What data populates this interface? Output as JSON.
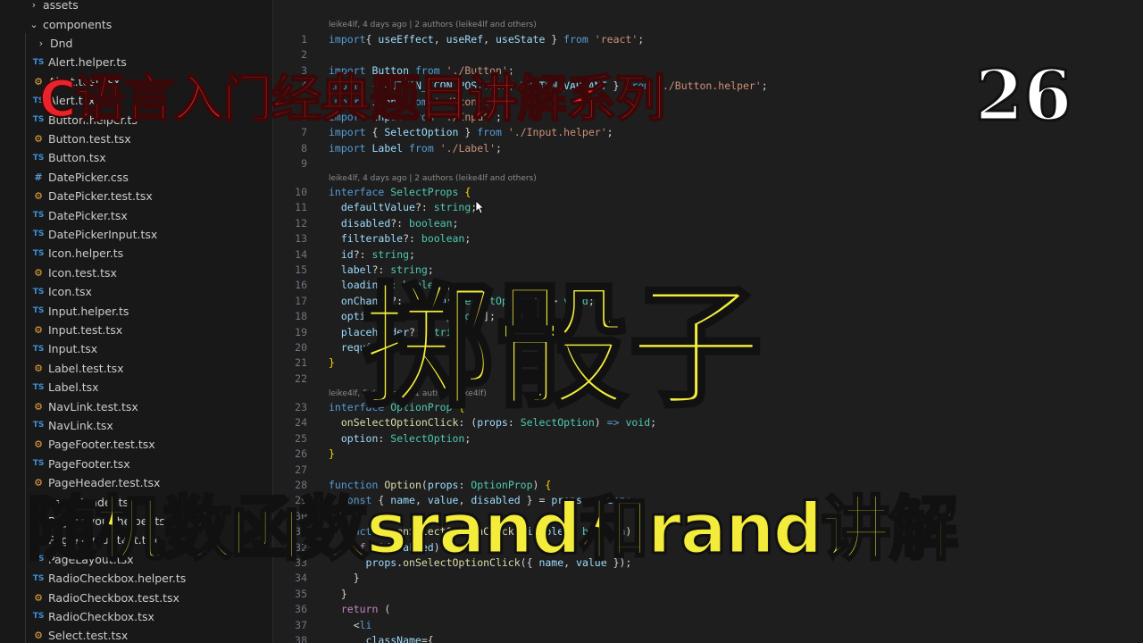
{
  "sidebar": {
    "items": [
      {
        "label": "assets",
        "kind": "folder",
        "chev": "›"
      },
      {
        "label": "components",
        "kind": "folder-open",
        "chev": "⌄"
      },
      {
        "label": "Dnd",
        "kind": "folder",
        "chev": "›"
      },
      {
        "label": "Alert.helper.ts",
        "kind": "ts"
      },
      {
        "label": "Alert.test.tsx",
        "kind": "test"
      },
      {
        "label": "Alert.tsx",
        "kind": "ts"
      },
      {
        "label": "Button.helper.ts",
        "kind": "ts"
      },
      {
        "label": "Button.test.tsx",
        "kind": "test"
      },
      {
        "label": "Button.tsx",
        "kind": "ts"
      },
      {
        "label": "DatePicker.css",
        "kind": "css"
      },
      {
        "label": "DatePicker.test.tsx",
        "kind": "test"
      },
      {
        "label": "DatePicker.tsx",
        "kind": "ts"
      },
      {
        "label": "DatePickerInput.tsx",
        "kind": "ts"
      },
      {
        "label": "Icon.helper.ts",
        "kind": "ts"
      },
      {
        "label": "Icon.test.tsx",
        "kind": "test"
      },
      {
        "label": "Icon.tsx",
        "kind": "ts"
      },
      {
        "label": "Input.helper.ts",
        "kind": "ts"
      },
      {
        "label": "Input.test.tsx",
        "kind": "test"
      },
      {
        "label": "Input.tsx",
        "kind": "ts"
      },
      {
        "label": "Label.test.tsx",
        "kind": "test"
      },
      {
        "label": "Label.tsx",
        "kind": "ts"
      },
      {
        "label": "NavLink.test.tsx",
        "kind": "test"
      },
      {
        "label": "NavLink.tsx",
        "kind": "ts"
      },
      {
        "label": "PageFooter.test.tsx",
        "kind": "test"
      },
      {
        "label": "PageFooter.tsx",
        "kind": "ts"
      },
      {
        "label": "PageHeader.test.tsx",
        "kind": "test"
      },
      {
        "label": "PageHeader.tsx",
        "kind": "ts"
      },
      {
        "label": "PageLayout.helper.ts",
        "kind": "ts"
      },
      {
        "label": "PageLayout.test.tsx",
        "kind": "test"
      },
      {
        "label": "PageLayout.tsx",
        "kind": "ts"
      },
      {
        "label": "RadioCheckbox.helper.ts",
        "kind": "ts"
      },
      {
        "label": "RadioCheckbox.test.tsx",
        "kind": "test"
      },
      {
        "label": "RadioCheckbox.tsx",
        "kind": "ts"
      },
      {
        "label": "Select.test.tsx",
        "kind": "test"
      }
    ],
    "icon_text": {
      "ts": "TS",
      "test": "⚙",
      "css": "#"
    }
  },
  "editor": {
    "blame": [
      {
        "text": "leike4lf, 4 days ago | 2 authors (leike4lf and others)",
        "before_line": 1
      },
      {
        "text": "leike4lf, 4 days ago | 2 authors (leike4lf and others)",
        "before_line": 10
      },
      {
        "text": "leike4lf, 5 days ago | 1 author (leike4lf)",
        "before_line": 23
      }
    ],
    "lines": [
      {
        "n": "1",
        "tokens": [
          [
            "kw",
            "import"
          ],
          [
            "",
            "{ "
          ],
          [
            "var",
            "useEffect"
          ],
          [
            "",
            ", "
          ],
          [
            "var",
            "useRef"
          ],
          [
            "",
            ", "
          ],
          [
            "var",
            "useState"
          ],
          [
            "",
            " } "
          ],
          [
            "kw",
            "from"
          ],
          [
            "",
            " "
          ],
          [
            "str",
            "'react'"
          ],
          [
            "",
            ";"
          ]
        ]
      },
      {
        "n": "2",
        "tokens": []
      },
      {
        "n": "3",
        "tokens": [
          [
            "kw",
            "import"
          ],
          [
            "",
            " "
          ],
          [
            "var",
            "Button"
          ],
          [
            "",
            " "
          ],
          [
            "kw",
            "from"
          ],
          [
            "",
            " "
          ],
          [
            "str",
            "'./Button'"
          ],
          [
            "",
            ";"
          ]
        ]
      },
      {
        "n": "4",
        "tokens": [
          [
            "kw",
            "import"
          ],
          [
            "",
            " { "
          ],
          [
            "var",
            "BUTTON_ICON_POSITION"
          ],
          [
            "",
            ", "
          ],
          [
            "var",
            "BUTTON_VARIANT"
          ],
          [
            "",
            " } "
          ],
          [
            "kw",
            "from"
          ],
          [
            "",
            " "
          ],
          [
            "str",
            "'./Button.helper'"
          ],
          [
            "",
            ";"
          ]
        ]
      },
      {
        "n": "5",
        "tokens": [
          [
            "kw",
            "import"
          ],
          [
            "",
            " "
          ],
          [
            "var",
            "Icon"
          ],
          [
            "",
            " "
          ],
          [
            "kw",
            "from"
          ],
          [
            "",
            " "
          ],
          [
            "str",
            "'./Icon'"
          ],
          [
            "",
            ";"
          ]
        ]
      },
      {
        "n": "6",
        "tokens": [
          [
            "kw",
            "import"
          ],
          [
            "",
            " "
          ],
          [
            "var",
            "Input"
          ],
          [
            "",
            " "
          ],
          [
            "kw",
            "from"
          ],
          [
            "",
            " "
          ],
          [
            "str",
            "'./Input'"
          ],
          [
            "",
            ";"
          ]
        ]
      },
      {
        "n": "7",
        "tokens": [
          [
            "kw",
            "import"
          ],
          [
            "",
            " { "
          ],
          [
            "var",
            "SelectOption"
          ],
          [
            "",
            " } "
          ],
          [
            "kw",
            "from"
          ],
          [
            "",
            " "
          ],
          [
            "str",
            "'./Input.helper'"
          ],
          [
            "",
            ";"
          ]
        ]
      },
      {
        "n": "8",
        "tokens": [
          [
            "kw",
            "import"
          ],
          [
            "",
            " "
          ],
          [
            "var",
            "Label"
          ],
          [
            "",
            " "
          ],
          [
            "kw",
            "from"
          ],
          [
            "",
            " "
          ],
          [
            "str",
            "'./Label'"
          ],
          [
            "",
            ";"
          ]
        ]
      },
      {
        "n": "9",
        "tokens": []
      },
      {
        "n": "10",
        "tokens": [
          [
            "kw",
            "interface"
          ],
          [
            "",
            " "
          ],
          [
            "type",
            "SelectProps"
          ],
          [
            "",
            " "
          ],
          [
            "punc",
            "{"
          ]
        ]
      },
      {
        "n": "11",
        "tokens": [
          [
            "",
            "  "
          ],
          [
            "var",
            "defaultValue"
          ],
          [
            "",
            "?: "
          ],
          [
            "type",
            "string"
          ],
          [
            "",
            ";"
          ]
        ]
      },
      {
        "n": "12",
        "tokens": [
          [
            "",
            "  "
          ],
          [
            "var",
            "disabled"
          ],
          [
            "",
            "?: "
          ],
          [
            "type",
            "boolean"
          ],
          [
            "",
            ";"
          ]
        ]
      },
      {
        "n": "13",
        "tokens": [
          [
            "",
            "  "
          ],
          [
            "var",
            "filterable"
          ],
          [
            "",
            "?: "
          ],
          [
            "type",
            "boolean"
          ],
          [
            "",
            ";"
          ]
        ]
      },
      {
        "n": "14",
        "tokens": [
          [
            "",
            "  "
          ],
          [
            "var",
            "id"
          ],
          [
            "",
            "?: "
          ],
          [
            "type",
            "string"
          ],
          [
            "",
            ";"
          ]
        ]
      },
      {
        "n": "15",
        "tokens": [
          [
            "",
            "  "
          ],
          [
            "var",
            "label"
          ],
          [
            "",
            "?: "
          ],
          [
            "type",
            "string"
          ],
          [
            "",
            ";"
          ]
        ]
      },
      {
        "n": "16",
        "tokens": [
          [
            "",
            "  "
          ],
          [
            "var",
            "loading"
          ],
          [
            "",
            "?: "
          ],
          [
            "type",
            "boolean"
          ],
          [
            "",
            ";"
          ]
        ]
      },
      {
        "n": "17",
        "tokens": [
          [
            "",
            "  "
          ],
          [
            "var",
            "onChange"
          ],
          [
            "",
            "?: ("
          ],
          [
            "var",
            "param"
          ],
          [
            "",
            ": "
          ],
          [
            "type",
            "SelectOption"
          ],
          [
            "",
            ") => "
          ],
          [
            "type",
            "void"
          ],
          [
            "",
            ";"
          ]
        ]
      },
      {
        "n": "18",
        "tokens": [
          [
            "",
            "  "
          ],
          [
            "var",
            "options"
          ],
          [
            "",
            "?: "
          ],
          [
            "type",
            "SelectOption"
          ],
          [
            "",
            "[];"
          ]
        ]
      },
      {
        "n": "19",
        "tokens": [
          [
            "",
            "  "
          ],
          [
            "var",
            "placeholder"
          ],
          [
            "",
            "?: "
          ],
          [
            "type",
            "string"
          ],
          [
            "",
            ";"
          ]
        ]
      },
      {
        "n": "20",
        "tokens": [
          [
            "",
            "  "
          ],
          [
            "var",
            "required"
          ],
          [
            "",
            "?: "
          ],
          [
            "type",
            "boolean"
          ],
          [
            "",
            ";"
          ]
        ]
      },
      {
        "n": "21",
        "tokens": [
          [
            "punc",
            "}"
          ]
        ]
      },
      {
        "n": "22",
        "tokens": []
      },
      {
        "n": "23",
        "tokens": [
          [
            "kw",
            "interface"
          ],
          [
            "",
            " "
          ],
          [
            "type",
            "OptionProp"
          ],
          [
            "",
            " "
          ],
          [
            "punc",
            "{"
          ]
        ]
      },
      {
        "n": "24",
        "tokens": [
          [
            "",
            "  "
          ],
          [
            "fn",
            "onSelectOptionClick"
          ],
          [
            "",
            ": ("
          ],
          [
            "var",
            "props"
          ],
          [
            "",
            ": "
          ],
          [
            "type",
            "SelectOption"
          ],
          [
            "",
            ") "
          ],
          [
            "kw",
            "=>"
          ],
          [
            "",
            " "
          ],
          [
            "type",
            "void"
          ],
          [
            "",
            ";"
          ]
        ]
      },
      {
        "n": "25",
        "tokens": [
          [
            "",
            "  "
          ],
          [
            "var",
            "option"
          ],
          [
            "",
            ": "
          ],
          [
            "type",
            "SelectOption"
          ],
          [
            "",
            ";"
          ]
        ]
      },
      {
        "n": "26",
        "tokens": [
          [
            "punc",
            "}"
          ]
        ]
      },
      {
        "n": "27",
        "tokens": []
      },
      {
        "n": "28",
        "tokens": [
          [
            "kw",
            "function"
          ],
          [
            "",
            " "
          ],
          [
            "fn",
            "Option"
          ],
          [
            "",
            "("
          ],
          [
            "var",
            "props"
          ],
          [
            "",
            ": "
          ],
          [
            "type",
            "OptionProp"
          ],
          [
            "",
            ") "
          ],
          [
            "punc",
            "{"
          ]
        ]
      },
      {
        "n": "29",
        "tokens": [
          [
            "",
            "  "
          ],
          [
            "kw",
            "const"
          ],
          [
            "",
            " { "
          ],
          [
            "var",
            "name"
          ],
          [
            "",
            ", "
          ],
          [
            "var",
            "value"
          ],
          [
            "",
            ", "
          ],
          [
            "var",
            "disabled"
          ],
          [
            "",
            " } = "
          ],
          [
            "var",
            "props"
          ],
          [
            "",
            "."
          ],
          [
            "var",
            "option"
          ],
          [
            "",
            ";"
          ]
        ]
      },
      {
        "n": "30",
        "tokens": []
      },
      {
        "n": "31",
        "tokens": [
          [
            "",
            "  "
          ],
          [
            "kw",
            "function"
          ],
          [
            "",
            " "
          ],
          [
            "fn",
            "onSelectOptionClick"
          ],
          [
            "",
            "("
          ],
          [
            "var",
            "disabled"
          ],
          [
            "",
            ": "
          ],
          [
            "type",
            "boolean"
          ],
          [
            "",
            ") {"
          ]
        ]
      },
      {
        "n": "32",
        "tokens": [
          [
            "",
            "    "
          ],
          [
            "ctl",
            "if"
          ],
          [
            "",
            " (!"
          ],
          [
            "var",
            "disabled"
          ],
          [
            "",
            ") {"
          ]
        ]
      },
      {
        "n": "33",
        "tokens": [
          [
            "",
            "      "
          ],
          [
            "var",
            "props"
          ],
          [
            "",
            "."
          ],
          [
            "fn",
            "onSelectOptionClick"
          ],
          [
            "",
            "({ "
          ],
          [
            "var",
            "name"
          ],
          [
            "",
            ", "
          ],
          [
            "var",
            "value"
          ],
          [
            "",
            " });"
          ]
        ]
      },
      {
        "n": "34",
        "tokens": [
          [
            "",
            "    }"
          ]
        ]
      },
      {
        "n": "35",
        "tokens": [
          [
            "",
            "  }"
          ]
        ]
      },
      {
        "n": "36",
        "tokens": [
          [
            "",
            "  "
          ],
          [
            "ctl",
            "return"
          ],
          [
            "",
            " ("
          ]
        ]
      },
      {
        "n": "37",
        "tokens": [
          [
            "",
            "    <"
          ],
          [
            "kw",
            "li"
          ]
        ]
      },
      {
        "n": "38",
        "tokens": [
          [
            "",
            "      "
          ],
          [
            "var",
            "className"
          ],
          [
            "",
            "={"
          ]
        ]
      }
    ]
  },
  "overlays": {
    "title": "C语言入门经典题目讲解系列",
    "number": "26",
    "topic": "掷骰子",
    "subtitle": "随机数函数srand和rand讲解"
  }
}
